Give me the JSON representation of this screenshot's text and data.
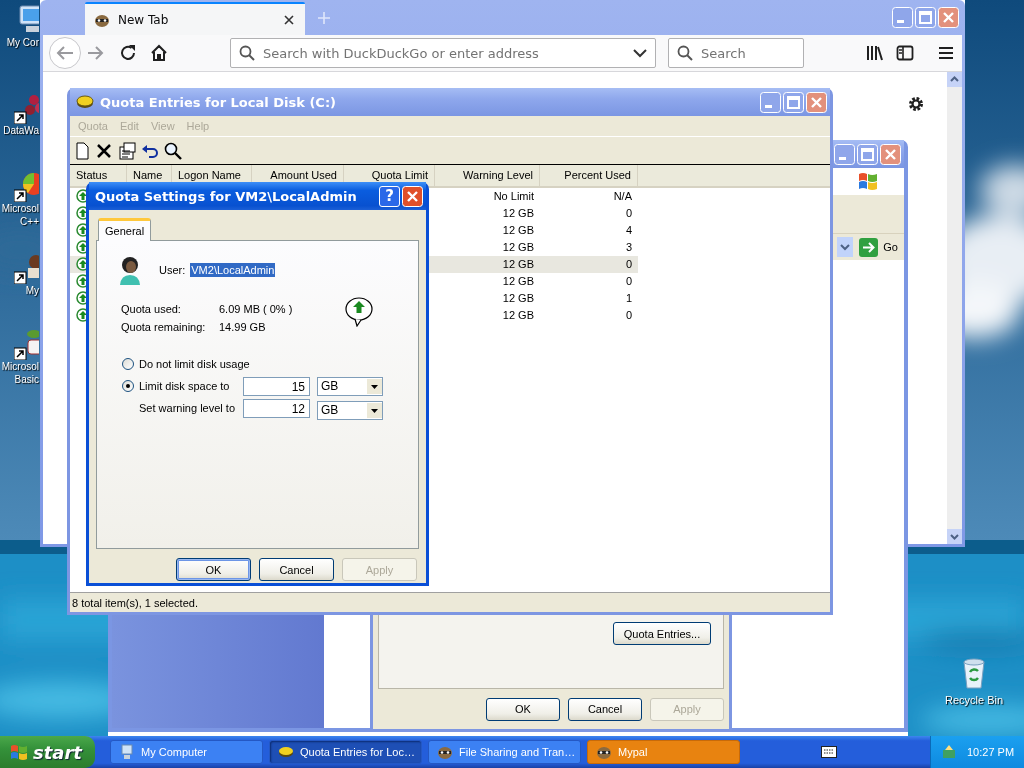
{
  "desktop_icons": [
    {
      "kind": "computer",
      "label_lines": [
        "My Cor"
      ]
    },
    {
      "kind": "chart",
      "label_lines": [
        "DataWa"
      ]
    },
    {
      "kind": "pie",
      "label_lines": [
        "Microsol",
        "C++"
      ]
    },
    {
      "kind": "app",
      "label_lines": [
        "My"
      ]
    },
    {
      "kind": "plant",
      "label_lines": [
        "Microsol",
        "Basic"
      ]
    }
  ],
  "recycle_bin": {
    "label": "Recycle Bin"
  },
  "browser": {
    "tab": {
      "title": "New Tab",
      "selected": true
    },
    "address_bar": {
      "placeholder": "Search with DuckDuckGo or enter address"
    },
    "search_box": {
      "placeholder": "Search"
    }
  },
  "explorer_window": {
    "go_button": "Go"
  },
  "properties_dialog": {
    "quota_entries_button": "Quota Entries...",
    "buttons": [
      {
        "label": "OK",
        "disabled": false
      },
      {
        "label": "Cancel",
        "disabled": false
      },
      {
        "label": "Apply",
        "disabled": true
      }
    ]
  },
  "quota_window": {
    "title": "Quota Entries for Local Disk (C:)",
    "menu": [
      {
        "label": "Quota",
        "disabled": true
      },
      {
        "label": "Edit",
        "disabled": true
      },
      {
        "label": "View",
        "disabled": true
      },
      {
        "label": "Help",
        "disabled": true
      }
    ],
    "columns": [
      "Status",
      "Name",
      "Logon Name",
      "Amount Used",
      "Quota Limit",
      "Warning Level",
      "Percent Used"
    ],
    "rows": [
      {
        "warning_level": "No Limit",
        "percent_used": "N/A",
        "selected": false
      },
      {
        "warning_level": "12 GB",
        "percent_used": "0",
        "selected": false
      },
      {
        "warning_level": "12 GB",
        "percent_used": "4",
        "selected": false
      },
      {
        "warning_level": "12 GB",
        "percent_used": "3",
        "selected": false
      },
      {
        "warning_level": "12 GB",
        "percent_used": "0",
        "selected": true
      },
      {
        "warning_level": "12 GB",
        "percent_used": "0",
        "selected": false
      },
      {
        "warning_level": "12 GB",
        "percent_used": "1",
        "selected": false
      },
      {
        "warning_level": "12 GB",
        "percent_used": "0",
        "selected": false
      }
    ],
    "status_bar": "8 total item(s), 1 selected."
  },
  "quota_dialog": {
    "title": "Quota Settings for VM2\\LocalAdmin",
    "help_button": "?",
    "tabs": [
      {
        "label": "General",
        "selected": true
      }
    ],
    "user_label": "User:",
    "user_value": "VM2\\LocalAdmin",
    "stats": [
      {
        "label": "Quota used:",
        "value": "6.09 MB ( 0% )"
      },
      {
        "label": "Quota remaining:",
        "value": "14.99 GB"
      }
    ],
    "limit_options": [
      {
        "label": "Do not limit disk usage",
        "selected": false
      },
      {
        "label": "Limit disk space to",
        "selected": true
      }
    ],
    "limit": {
      "value": "15",
      "unit": "GB"
    },
    "warning": {
      "label": "Set warning level to",
      "value": "12",
      "unit": "GB"
    },
    "buttons": [
      {
        "label": "OK",
        "disabled": false,
        "default": true
      },
      {
        "label": "Cancel",
        "disabled": false,
        "default": false
      },
      {
        "label": "Apply",
        "disabled": true,
        "default": false
      }
    ]
  },
  "taskbar": {
    "start": "start",
    "tasks": [
      {
        "label": "My Computer",
        "selected": false,
        "flashing": false
      },
      {
        "label": "Quota Entries for Loc…",
        "selected": true,
        "flashing": false
      },
      {
        "label": "File Sharing and Tran…",
        "selected": false,
        "flashing": false
      },
      {
        "label": "Mypal",
        "selected": false,
        "flashing": true
      }
    ],
    "clock": "10:27 PM"
  }
}
